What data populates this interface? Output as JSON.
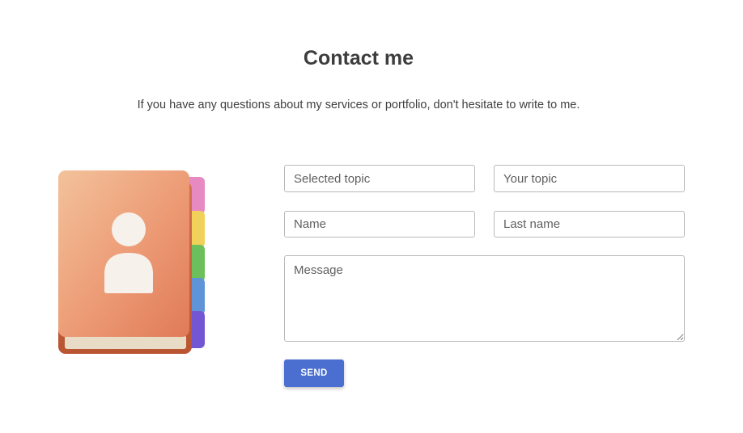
{
  "header": {
    "title": "Contact me",
    "subtitle": "If you have any questions about my services or portfolio, don't hesitate to write to me."
  },
  "illustration": {
    "icon": "contact-book-icon",
    "colors": {
      "cover": "#e98a68",
      "tab_pink": "#e78ac2",
      "tab_yellow": "#f0d25a",
      "tab_green": "#6cbf5a",
      "tab_blue": "#5f94d8",
      "tab_purple": "#7256d4"
    }
  },
  "form": {
    "selected_topic": {
      "placeholder": "Selected topic",
      "value": ""
    },
    "your_topic": {
      "placeholder": "Your topic",
      "value": ""
    },
    "name": {
      "placeholder": "Name",
      "value": ""
    },
    "last_name": {
      "placeholder": "Last name",
      "value": ""
    },
    "message": {
      "placeholder": "Message",
      "value": ""
    },
    "send_label": "SEND"
  },
  "colors": {
    "accent": "#4a6fd0",
    "border": "#b9b9b9",
    "text": "#3d3d3d"
  }
}
